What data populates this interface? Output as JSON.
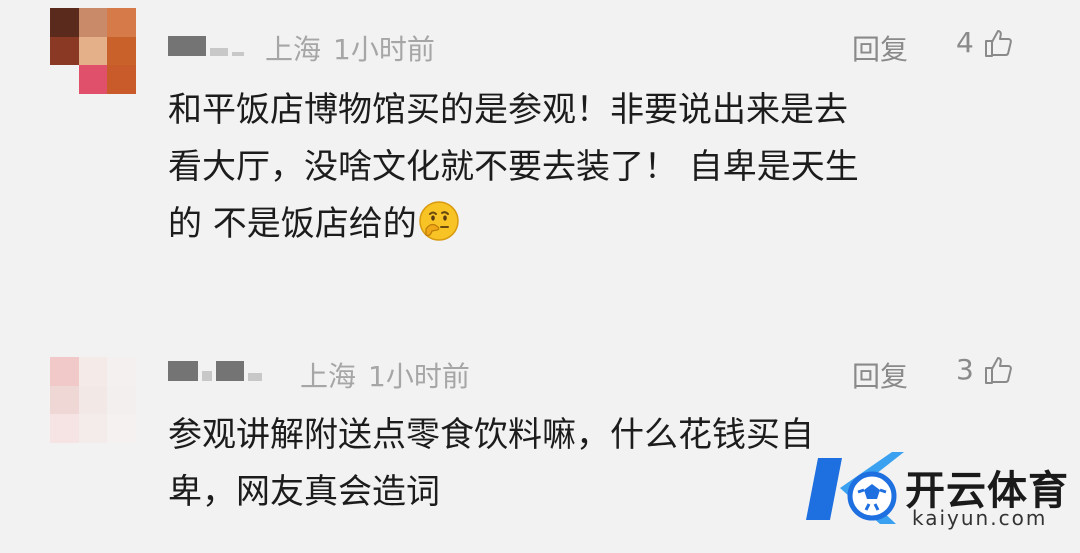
{
  "comments": [
    {
      "location": "上海",
      "time": "1小时前",
      "reply_label": "回复",
      "likes": "4",
      "lines": [
        "和平饭店博物馆买的是参观！非要说出来是去",
        "看大厅，没啥文化就不要去装了！  自卑是天生",
        "的 不是饭店给的"
      ],
      "emoji": "thinking-face"
    },
    {
      "location": "上海",
      "time": "1小时前",
      "reply_label": "回复",
      "likes": "3",
      "lines": [
        "参观讲解附送点零食饮料嘛，什么花钱买自",
        "卑，网友真会造词"
      ]
    }
  ],
  "watermark": {
    "brand": "开云体育",
    "domain": "kaiyun.com"
  },
  "colors": {
    "background": "#f2f2f2",
    "meta": "#a6a6a6",
    "text": "#1c1c1c",
    "logo_blue": "#1e6fe0"
  }
}
